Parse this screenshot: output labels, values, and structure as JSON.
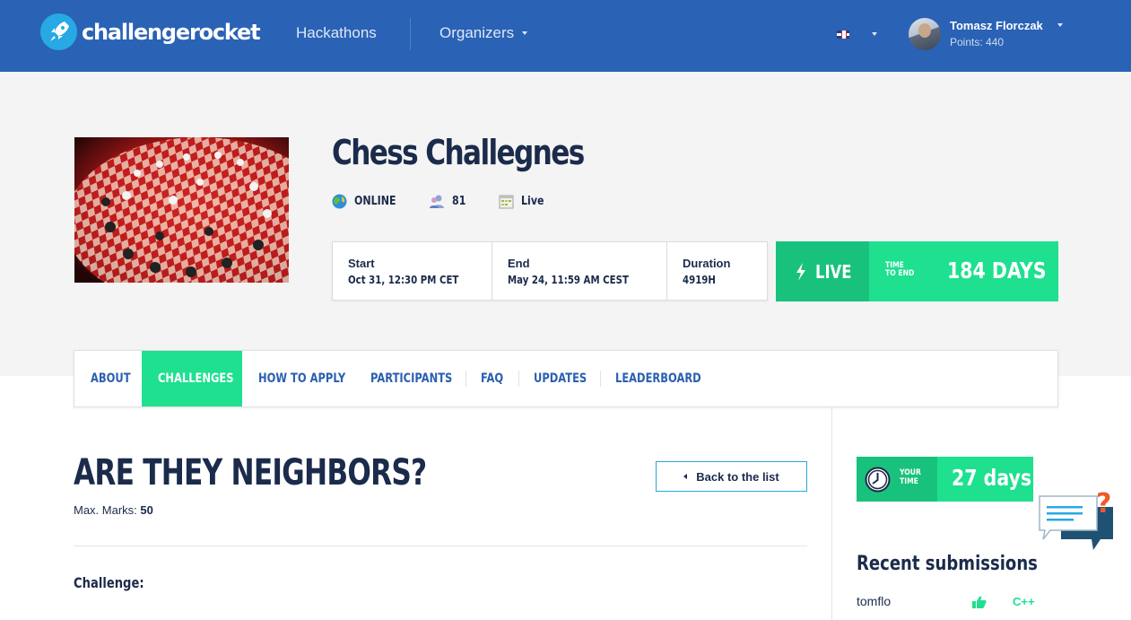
{
  "header": {
    "logo_text": "challengerocket",
    "nav": {
      "hackathons": "Hackathons",
      "organizers": "Organizers"
    },
    "user": {
      "name": "Tomasz Florczak",
      "points": "Points: 440"
    }
  },
  "hero": {
    "title": "Chess Challegnes",
    "meta": {
      "location": "ONLINE",
      "participants": "81",
      "status": "Live"
    },
    "dates": {
      "start_label": "Start",
      "start_value": "Oct 31, 12:30 PM CET",
      "end_label": "End",
      "end_value": "May 24, 11:59 AM CEST",
      "duration_label": "Duration",
      "duration_value": "4919H"
    },
    "live": {
      "label": "LIVE",
      "time_to_end_line1": "TIME",
      "time_to_end_line2": "TO END",
      "days": "184 DAYS"
    }
  },
  "tabs": [
    "ABOUT",
    "CHALLENGES",
    "HOW TO APPLY",
    "PARTICIPANTS",
    "FAQ",
    "UPDATES",
    "LEADERBOARD"
  ],
  "challenge": {
    "title": "ARE THEY NEIGHBORS?",
    "max_marks_label": "Max. Marks: ",
    "max_marks_value": "50",
    "back_button": "Back to the list",
    "section_label": "Challenge:"
  },
  "sidebar": {
    "your_time_line1": "YOUR",
    "your_time_line2": "TIME",
    "your_time_value": "27 days",
    "recent_title": "Recent submissions",
    "submissions": [
      {
        "user": "tomflo",
        "language": "C++"
      }
    ]
  },
  "colors": {
    "nav_blue": "#2a62b5",
    "green": "#1ee08f",
    "green_dark": "#19c27c",
    "navy": "#1b2b4b",
    "link_blue": "#2a5fb0"
  }
}
